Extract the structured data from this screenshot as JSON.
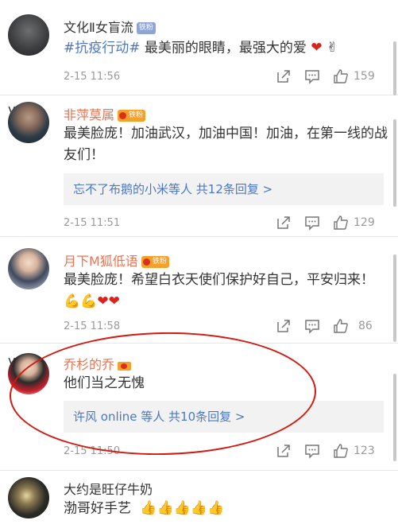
{
  "comments": [
    {
      "username": "文化Ⅱ女盲流",
      "badge": "铁粉",
      "topic": "#抗疫行动#",
      "text": " 最美丽的眼睛，最强大的爱",
      "time": "2-15 11:56",
      "likes": "159"
    },
    {
      "username": "非萍莫属",
      "badge": "铁粉",
      "text": "最美脸庞！加油武汉，加油中国！加油，在第一线的战友们！",
      "reply": "忘不了布鹅的小米等人  共12条回复 >",
      "time": "2-15 11:51",
      "likes": "129"
    },
    {
      "username": "月下M狐低语",
      "badge": "铁粉",
      "text": "最美脸庞！希望白衣天使们保护好自己，平安归来！",
      "time": "2-15 11:58",
      "likes": "86"
    },
    {
      "username": "乔杉的乔",
      "text": "他们当之无愧",
      "reply": "许风 online 等人  共10条回复 >",
      "time": "2-15 11:50",
      "likes": "123"
    },
    {
      "username": "大约是旺仔牛奶",
      "text": "渤哥好手艺"
    }
  ],
  "icons": {
    "share": "share-icon",
    "comment": "comment-icon",
    "like": "thumbs-up-icon",
    "verified": "verified-v-icon"
  },
  "colors": {
    "username": "#eb7350",
    "link": "#4a78c5",
    "annotation": "#d21a10"
  }
}
